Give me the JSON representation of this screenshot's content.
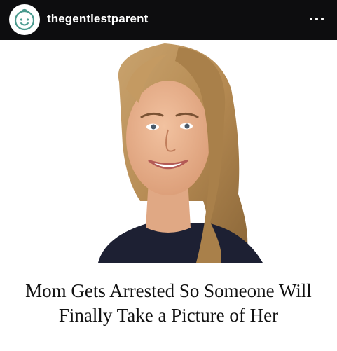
{
  "account": {
    "username": "thegentlestparent",
    "avatar_icon": "baby-face-icon",
    "avatar_color": "#4a9a8e"
  },
  "header": {
    "background": "#0d0d0f",
    "more_icon": "ellipsis-icon"
  },
  "post": {
    "headline_line1": "Mom Gets Arrested So Someone Will",
    "headline_line2": "Finally Take a Picture of Her"
  }
}
